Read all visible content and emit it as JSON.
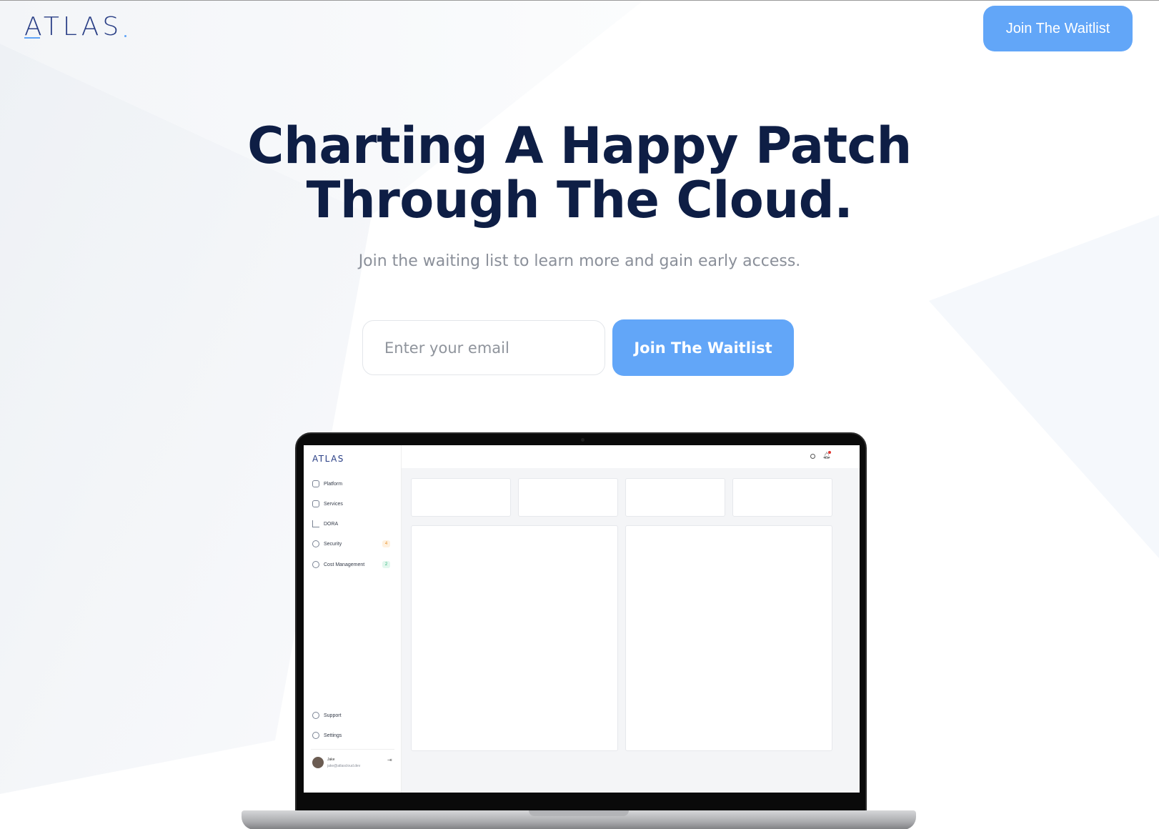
{
  "header": {
    "logo_text": "ATLAS",
    "cta_label": "Join The Waitlist"
  },
  "hero": {
    "title_line1": "Charting A Happy Patch",
    "title_line2": "Through The Cloud.",
    "subtitle": "Join the waiting list to learn more and gain early access.",
    "email_placeholder": "Enter your email",
    "cta_label": "Join The Waitlist"
  },
  "preview": {
    "logo_text": "ATLAS",
    "nav_items": [
      {
        "label": "Platform",
        "icon": "platform-icon"
      },
      {
        "label": "Services",
        "icon": "layers-icon"
      },
      {
        "label": "DORA",
        "icon": "bar-chart-icon"
      },
      {
        "label": "Security",
        "icon": "shield-icon",
        "badge": "4"
      },
      {
        "label": "Cost Management",
        "icon": "dollar-icon",
        "badge": "2"
      }
    ],
    "footer_items": [
      {
        "label": "Support",
        "icon": "support-icon"
      },
      {
        "label": "Settings",
        "icon": "gear-icon"
      }
    ],
    "user": {
      "name": "Jake",
      "email": "jake@atlascloud.dev"
    }
  },
  "colors": {
    "accent": "#62a6f8",
    "heading": "#0e1e45",
    "brand": "#2a3f86"
  }
}
